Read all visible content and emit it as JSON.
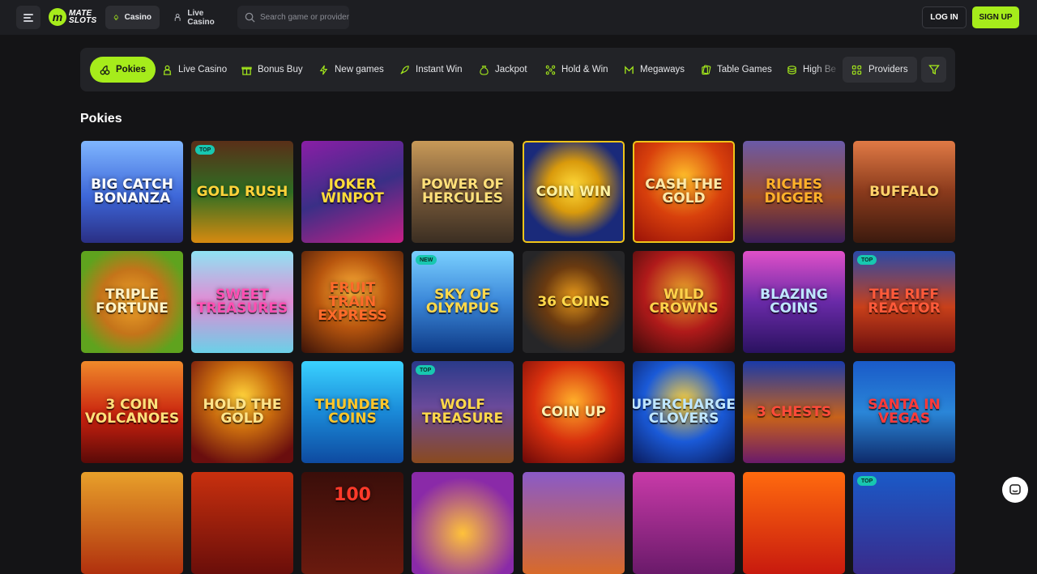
{
  "header": {
    "logo_top": "MATE",
    "logo_bottom": "SLOTS",
    "tabs": [
      {
        "label": "Casino",
        "icon": "spade-icon"
      },
      {
        "label": "Live Casino",
        "icon": "dealer-icon"
      }
    ],
    "search_placeholder": "Search game or provider",
    "login_label": "LOG IN",
    "signup_label": "SIGN UP"
  },
  "categories": [
    {
      "label": "Pokies",
      "icon": "cherries-icon",
      "active": true
    },
    {
      "label": "Live Casino",
      "icon": "dealer-icon"
    },
    {
      "label": "Bonus Buy",
      "icon": "gift-icon"
    },
    {
      "label": "New games",
      "icon": "lightning-icon"
    },
    {
      "label": "Instant Win",
      "icon": "rocket-icon"
    },
    {
      "label": "Jackpot",
      "icon": "moneybag-icon"
    },
    {
      "label": "Hold & Win",
      "icon": "dots-grid-icon"
    },
    {
      "label": "Megaways",
      "icon": "megaways-icon"
    },
    {
      "label": "Table Games",
      "icon": "cards-icon"
    },
    {
      "label": "High Be",
      "icon": "chips-icon"
    }
  ],
  "providers_label": "Providers",
  "section_title": "Pokies",
  "games": [
    {
      "title": "Big Catch Bonanza",
      "badge": ""
    },
    {
      "title": "Gold Rush",
      "badge": "TOP"
    },
    {
      "title": "Joker Winpot",
      "badge": ""
    },
    {
      "title": "Power of Hercules",
      "badge": ""
    },
    {
      "title": "Coin Win",
      "badge": ""
    },
    {
      "title": "Cash the Gold",
      "badge": ""
    },
    {
      "title": "Riches Digger",
      "badge": ""
    },
    {
      "title": "Buffalo",
      "badge": ""
    },
    {
      "title": "Triple Fortune",
      "badge": ""
    },
    {
      "title": "Sweet Treasures",
      "badge": ""
    },
    {
      "title": "Fruit Train Express",
      "badge": ""
    },
    {
      "title": "Sky of Olympus",
      "badge": "NEW"
    },
    {
      "title": "36 Coins",
      "badge": ""
    },
    {
      "title": "Wild Crowns",
      "badge": ""
    },
    {
      "title": "Blazing Coins",
      "badge": ""
    },
    {
      "title": "The Riff Reactor",
      "badge": "TOP"
    },
    {
      "title": "3 Coin Volcanoes",
      "badge": ""
    },
    {
      "title": "Hold the Gold",
      "badge": ""
    },
    {
      "title": "Thunder Coins",
      "badge": ""
    },
    {
      "title": "Wolf Treasure",
      "badge": "TOP"
    },
    {
      "title": "Coin Up",
      "badge": ""
    },
    {
      "title": "Supercharged Clovers",
      "badge": ""
    },
    {
      "title": "3 Chests",
      "badge": ""
    },
    {
      "title": "Santa in Vegas",
      "badge": ""
    },
    {
      "title": "",
      "badge": ""
    },
    {
      "title": "",
      "badge": ""
    },
    {
      "title": "100",
      "badge": ""
    },
    {
      "title": "",
      "badge": ""
    },
    {
      "title": "",
      "badge": ""
    },
    {
      "title": "",
      "badge": ""
    },
    {
      "title": "",
      "badge": ""
    },
    {
      "title": "",
      "badge": "TOP"
    }
  ],
  "colors": {
    "accent": "#a6ec1b",
    "background": "#141416",
    "badge": "#18c7b0"
  }
}
